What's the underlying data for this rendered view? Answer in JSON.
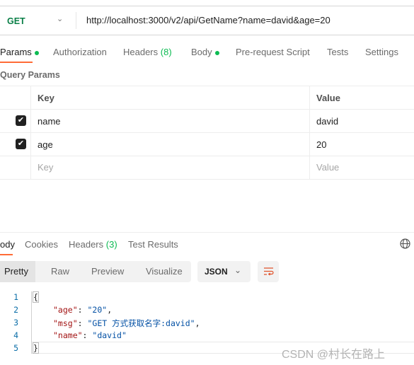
{
  "request": {
    "method": "GET",
    "url": "http://localhost:3000/v2/api/GetName?name=david&age=20"
  },
  "request_tabs": [
    {
      "label": "Params",
      "dot": true
    },
    {
      "label": "Authorization"
    },
    {
      "label": "Headers",
      "count": "(8)"
    },
    {
      "label": "Body",
      "dot": true
    },
    {
      "label": "Pre-request Script"
    },
    {
      "label": "Tests"
    },
    {
      "label": "Settings"
    }
  ],
  "params": {
    "title": "Query Params",
    "headers": {
      "key": "Key",
      "value": "Value"
    },
    "rows": [
      {
        "checked": true,
        "key": "name",
        "value": "david"
      },
      {
        "checked": true,
        "key": "age",
        "value": "20"
      }
    ],
    "placeholder": {
      "key": "Key",
      "value": "Value"
    }
  },
  "response_tabs": [
    {
      "label": "ody"
    },
    {
      "label": "Cookies"
    },
    {
      "label": "Headers",
      "count": "(3)"
    },
    {
      "label": "Test Results"
    }
  ],
  "view_modes": [
    "Pretty",
    "Raw",
    "Preview",
    "Visualize"
  ],
  "format": "JSON",
  "code": {
    "line_numbers": [
      "1",
      "2",
      "3",
      "4",
      "5"
    ],
    "open": "{",
    "close": "}",
    "lines": [
      {
        "key": "\"age\"",
        "value": "\"20\"",
        "comma": ","
      },
      {
        "key": "\"msg\"",
        "value": "\"GET 方式获取名字:david\"",
        "comma": ","
      },
      {
        "key": "\"name\"",
        "value": "\"david\"",
        "comma": ""
      }
    ]
  },
  "watermark": "CSDN @村长在路上",
  "colors": {
    "accent": "#ff6c37",
    "get": "#0a7f47",
    "dot": "#0cbb52"
  }
}
